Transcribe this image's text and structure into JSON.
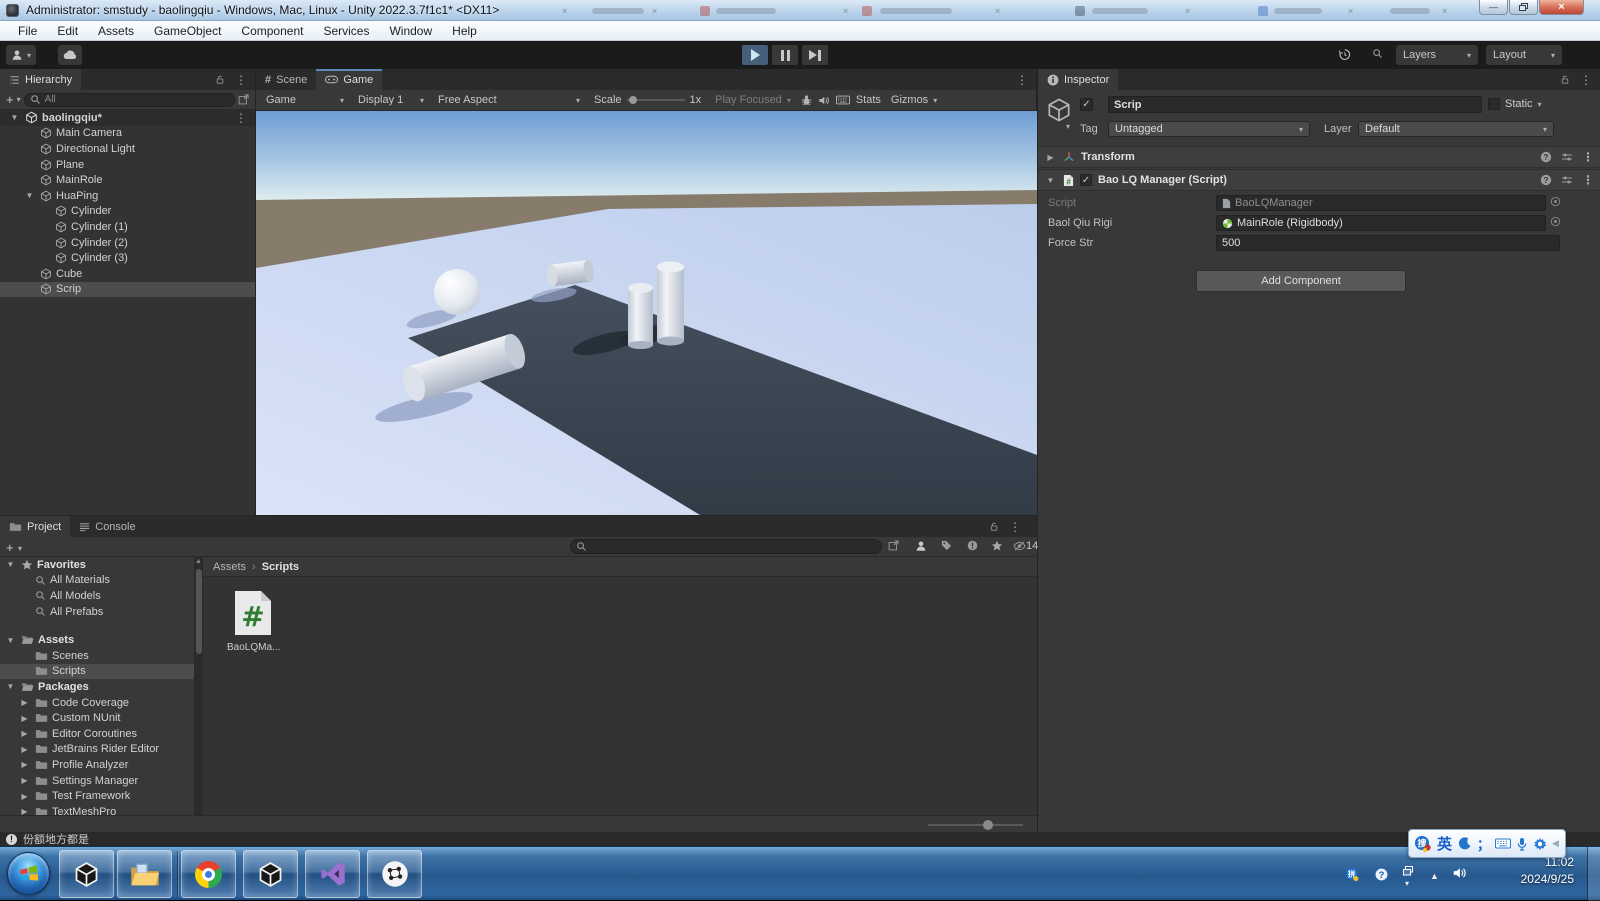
{
  "window": {
    "title": "Administrator: smstudy - baolingqiu - Windows, Mac, Linux - Unity 2022.3.7f1c1* <DX11>"
  },
  "menubar": {
    "items": [
      "File",
      "Edit",
      "Assets",
      "GameObject",
      "Component",
      "Services",
      "Window",
      "Help"
    ]
  },
  "toolbar": {
    "layers": "Layers",
    "layout": "Layout"
  },
  "hierarchy": {
    "tab": "Hierarchy",
    "search_placeholder": "All",
    "items": [
      {
        "label": "baolingqiu*",
        "icon": "scene",
        "depth": 0,
        "expand": "open",
        "header": true
      },
      {
        "label": "Main Camera",
        "icon": "cube",
        "depth": 1
      },
      {
        "label": "Directional Light",
        "icon": "cube",
        "depth": 1
      },
      {
        "label": "Plane",
        "icon": "cube",
        "depth": 1
      },
      {
        "label": "MainRole",
        "icon": "cube",
        "depth": 1
      },
      {
        "label": "HuaPing",
        "icon": "cube",
        "depth": 1,
        "expand": "open"
      },
      {
        "label": "Cylinder",
        "icon": "cube",
        "depth": 2
      },
      {
        "label": "Cylinder (1)",
        "icon": "cube",
        "depth": 2
      },
      {
        "label": "Cylinder (2)",
        "icon": "cube",
        "depth": 2
      },
      {
        "label": "Cylinder (3)",
        "icon": "cube",
        "depth": 2
      },
      {
        "label": "Cube",
        "icon": "cube",
        "depth": 1
      },
      {
        "label": "Scrip",
        "icon": "cube",
        "depth": 1,
        "selected": true
      }
    ]
  },
  "game": {
    "tab_scene": "Scene",
    "tab_game": "Game",
    "display_target": "Game",
    "display": "Display 1",
    "aspect": "Free Aspect",
    "scale_label": "Scale",
    "scale_value": "1x",
    "play_focused": "Play Focused",
    "stats_label": "Stats",
    "gizmos_label": "Gizmos"
  },
  "inspector": {
    "tab": "Inspector",
    "name": "Scrip",
    "static_label": "Static",
    "tag_label": "Tag",
    "tag_value": "Untagged",
    "layer_label": "Layer",
    "layer_value": "Default",
    "transform_label": "Transform",
    "script_header": "Bao LQ Manager (Script)",
    "rows": {
      "script_label": "Script",
      "script_value": "BaoLQManager",
      "rigid_label": "Baol Qiu Rigi",
      "rigid_value": "MainRole (Rigidbody)",
      "force_label": "Force Str",
      "force_value": "500"
    },
    "add_component": "Add Component"
  },
  "project": {
    "tab_project": "Project",
    "tab_console": "Console",
    "breadcrumb_root": "Assets",
    "breadcrumb_leaf": "Scripts",
    "asset_label": "BaoLQMa...",
    "hidden_count": "14",
    "tree": [
      {
        "label": "Favorites",
        "icon": "star",
        "depth": 0,
        "expand": "open",
        "bold": true
      },
      {
        "label": "All Materials",
        "icon": "search",
        "depth": 1
      },
      {
        "label": "All Models",
        "icon": "search",
        "depth": 1
      },
      {
        "label": "All Prefabs",
        "icon": "search",
        "depth": 1
      },
      {
        "spacer": true
      },
      {
        "label": "Assets",
        "icon": "folderOpen",
        "depth": 0,
        "expand": "open",
        "bold": true
      },
      {
        "label": "Scenes",
        "icon": "folder",
        "depth": 1
      },
      {
        "label": "Scripts",
        "icon": "folder",
        "depth": 1,
        "selected": true
      },
      {
        "label": "Packages",
        "icon": "folderOpen",
        "depth": 0,
        "expand": "open",
        "bold": true
      },
      {
        "label": "Code Coverage",
        "icon": "folder",
        "depth": 1,
        "expand": "closed"
      },
      {
        "label": "Custom NUnit",
        "icon": "folder",
        "depth": 1,
        "expand": "closed"
      },
      {
        "label": "Editor Coroutines",
        "icon": "folder",
        "depth": 1,
        "expand": "closed"
      },
      {
        "label": "JetBrains Rider Editor",
        "icon": "folder",
        "depth": 1,
        "expand": "closed"
      },
      {
        "label": "Profile Analyzer",
        "icon": "folder",
        "depth": 1,
        "expand": "closed"
      },
      {
        "label": "Settings Manager",
        "icon": "folder",
        "depth": 1,
        "expand": "closed"
      },
      {
        "label": "Test Framework",
        "icon": "folder",
        "depth": 1,
        "expand": "closed"
      },
      {
        "label": "TextMeshPro",
        "icon": "folder",
        "depth": 1,
        "expand": "closed"
      }
    ]
  },
  "statusbar": {
    "message": "份额地方都是"
  },
  "taskbar": {
    "time": "11:02",
    "date": "2024/9/25",
    "buttons": [
      "unity-hub",
      "file-explorer",
      "chrome",
      "unity-editor",
      "visual-studio",
      "auto-clicker"
    ],
    "ime": {
      "mode_cn": "英",
      "punct": "；"
    }
  },
  "colors": {
    "play_active": "#46607c",
    "selection": "#4d4d4d",
    "game_tab_accent": "#5d88b6",
    "taskbar_blue": "#2e6196",
    "script_icon_green": "#2f7d32"
  }
}
